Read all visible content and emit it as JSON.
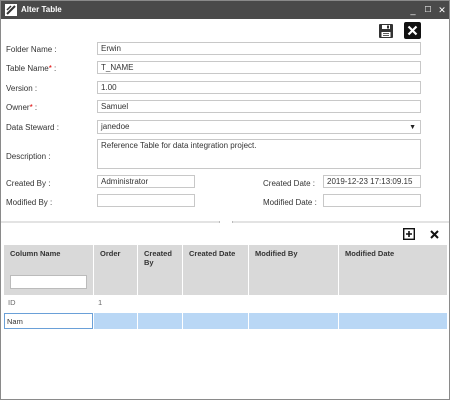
{
  "window": {
    "title": "Alter Table",
    "minimize": "_",
    "maximize": "☐",
    "close": "✕"
  },
  "toolbar": {
    "save_icon": "save-icon",
    "close_icon": "close-icon"
  },
  "form": {
    "folder_name_label": "Folder Name :",
    "folder_name_value": "Erwin",
    "table_name_label": "Table Name",
    "table_name_req": "*",
    "table_name_colon": " :",
    "table_name_value": "T_NAME",
    "version_label": "Version :",
    "version_value": "1.00",
    "owner_label": "Owner",
    "owner_req": "*",
    "owner_colon": " :",
    "owner_value": "Samuel",
    "data_steward_label": "Data Steward :",
    "data_steward_value": "janedoe",
    "data_steward_arrow": "▼",
    "description_label": "Description :",
    "description_value": "Reference Table for data integration project.",
    "created_by_label": "Created By :",
    "created_by_value": "Administrator",
    "created_date_label": "Created Date :",
    "created_date_value": "2019-12-23 17:13:09.15",
    "modified_by_label": "Modified By :",
    "modified_by_value": "",
    "modified_date_label": "Modified Date :",
    "modified_date_value": ""
  },
  "grid_toolbar": {
    "add_icon": "add-icon",
    "delete_icon": "delete-icon"
  },
  "grid": {
    "columns": [
      "Column Name",
      "Order",
      "Created By",
      "Created Date",
      "Modified By",
      "Modified Date"
    ],
    "rows": [
      {
        "column_name": "ID",
        "order": "1",
        "created_by": "",
        "created_date": "",
        "modified_by": "",
        "modified_date": ""
      }
    ],
    "editing_value": "Nam"
  }
}
